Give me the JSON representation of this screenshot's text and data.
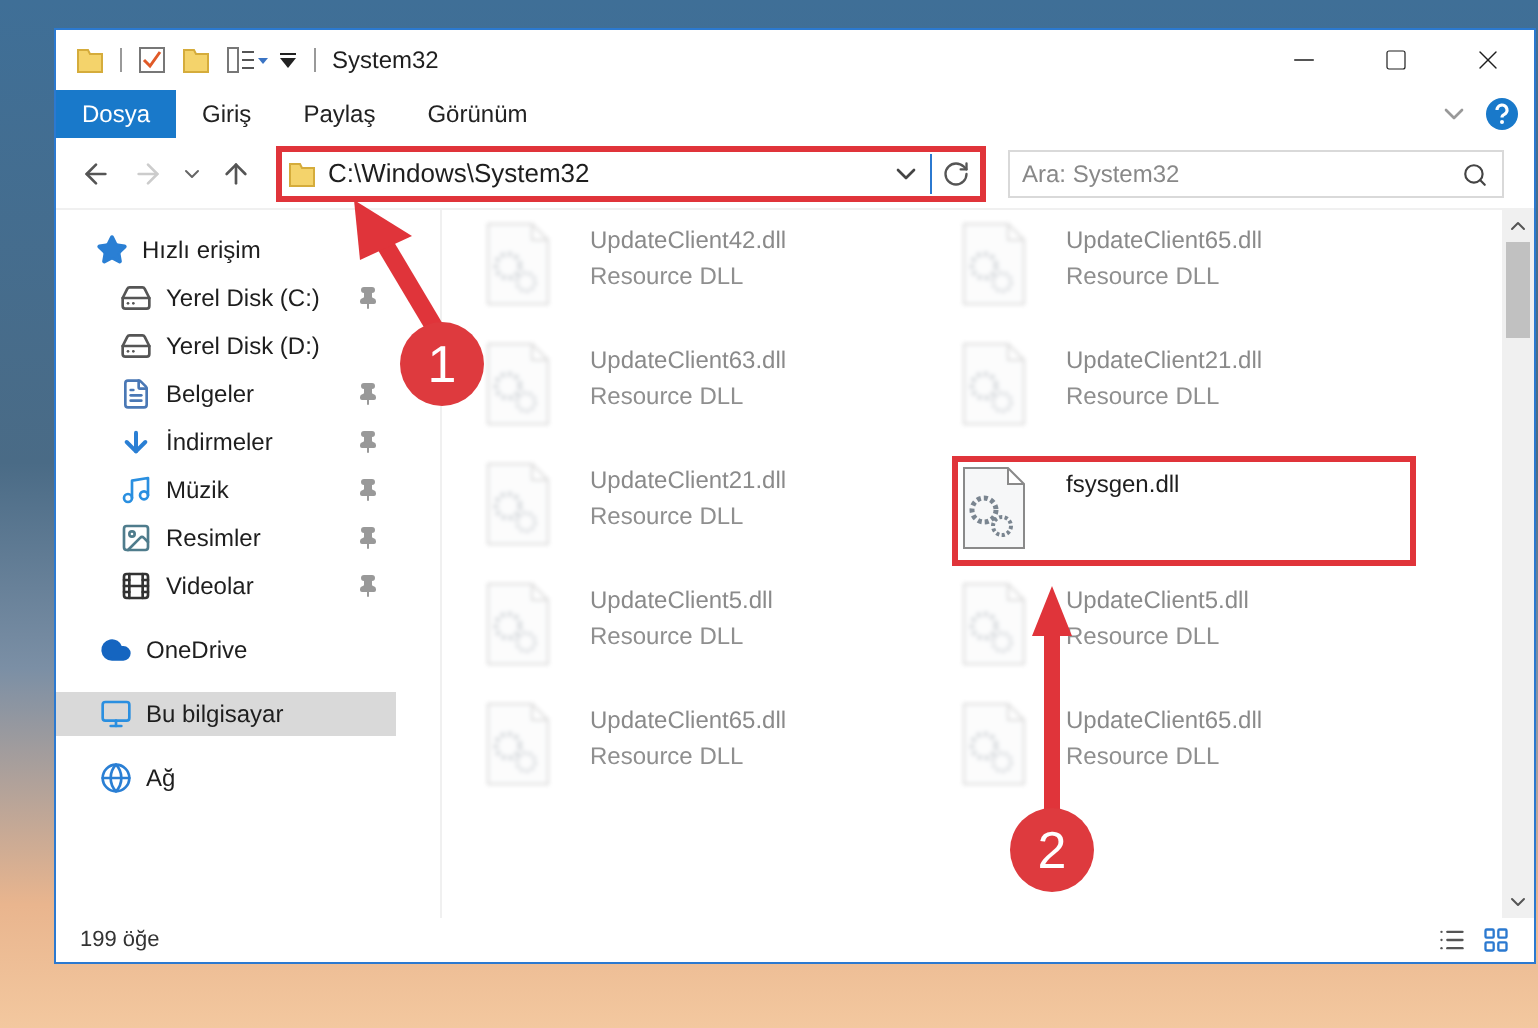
{
  "window": {
    "title": "System32"
  },
  "ribbon_tabs": [
    {
      "label": "Dosya",
      "selected": true
    },
    {
      "label": "Giriş",
      "selected": false
    },
    {
      "label": "Paylaş",
      "selected": false
    },
    {
      "label": "Görünüm",
      "selected": false
    }
  ],
  "navigation": {
    "back_disabled": false,
    "forward_disabled": true
  },
  "address": {
    "path": "C:\\Windows\\System32",
    "highlighted": true
  },
  "search": {
    "placeholder": "Ara: System32"
  },
  "sidebar": {
    "items": [
      {
        "label": "Hızlı erişim",
        "kind": "quick",
        "selected": false,
        "children": [
          {
            "label": "Yerel Disk (C:)",
            "kind": "drive-c",
            "selected": false,
            "pinned": true
          },
          {
            "label": "Yerel Disk (D:)",
            "kind": "drive",
            "selected": false,
            "pinned": false
          },
          {
            "label": "Belgeler",
            "kind": "documents",
            "selected": false,
            "pinned": true
          },
          {
            "label": "İndirmeler",
            "kind": "downloads",
            "selected": false,
            "pinned": true
          },
          {
            "label": "Müzik",
            "kind": "music",
            "selected": false,
            "pinned": true
          },
          {
            "label": "Resimler",
            "kind": "pictures",
            "selected": false,
            "pinned": true
          },
          {
            "label": "Videolar",
            "kind": "videos",
            "selected": false,
            "pinned": true
          }
        ]
      },
      {
        "label": "OneDrive",
        "kind": "cloud",
        "selected": false
      },
      {
        "label": "Bu bilgisayar",
        "kind": "pc",
        "selected": true
      },
      {
        "label": "Ağ",
        "kind": "network",
        "selected": false
      }
    ]
  },
  "files": [
    {
      "name": "UpdateClient42.dll",
      "type": "Resource DLL",
      "blurred": true,
      "highlighted": false
    },
    {
      "name": "UpdateClient65.dll",
      "type": "Resource DLL",
      "blurred": true,
      "highlighted": false
    },
    {
      "name": "UpdateClient63.dll",
      "type": "Resource DLL",
      "blurred": true,
      "highlighted": false
    },
    {
      "name": "UpdateClient21.dll",
      "type": "Resource DLL",
      "blurred": true,
      "highlighted": false
    },
    {
      "name": "UpdateClient21.dll",
      "type": "Resource DLL",
      "blurred": true,
      "highlighted": false
    },
    {
      "name": "fsysgen.dll",
      "blurred": false,
      "highlighted": true
    },
    {
      "name": "UpdateClient5.dll",
      "type": "Resource DLL",
      "blurred": true,
      "highlighted": false
    },
    {
      "name": "UpdateClient5.dll",
      "type": "Resource DLL",
      "blurred": true,
      "highlighted": false
    },
    {
      "name": "UpdateClient65.dll",
      "type": "Resource DLL",
      "blurred": true,
      "highlighted": false
    },
    {
      "name": "UpdateClient65.dll",
      "type": "Resource DLL",
      "blurred": true,
      "highlighted": false
    }
  ],
  "annotations": [
    {
      "label": "1"
    },
    {
      "label": "2"
    }
  ],
  "status_bar": {
    "count": "199 öğe"
  }
}
